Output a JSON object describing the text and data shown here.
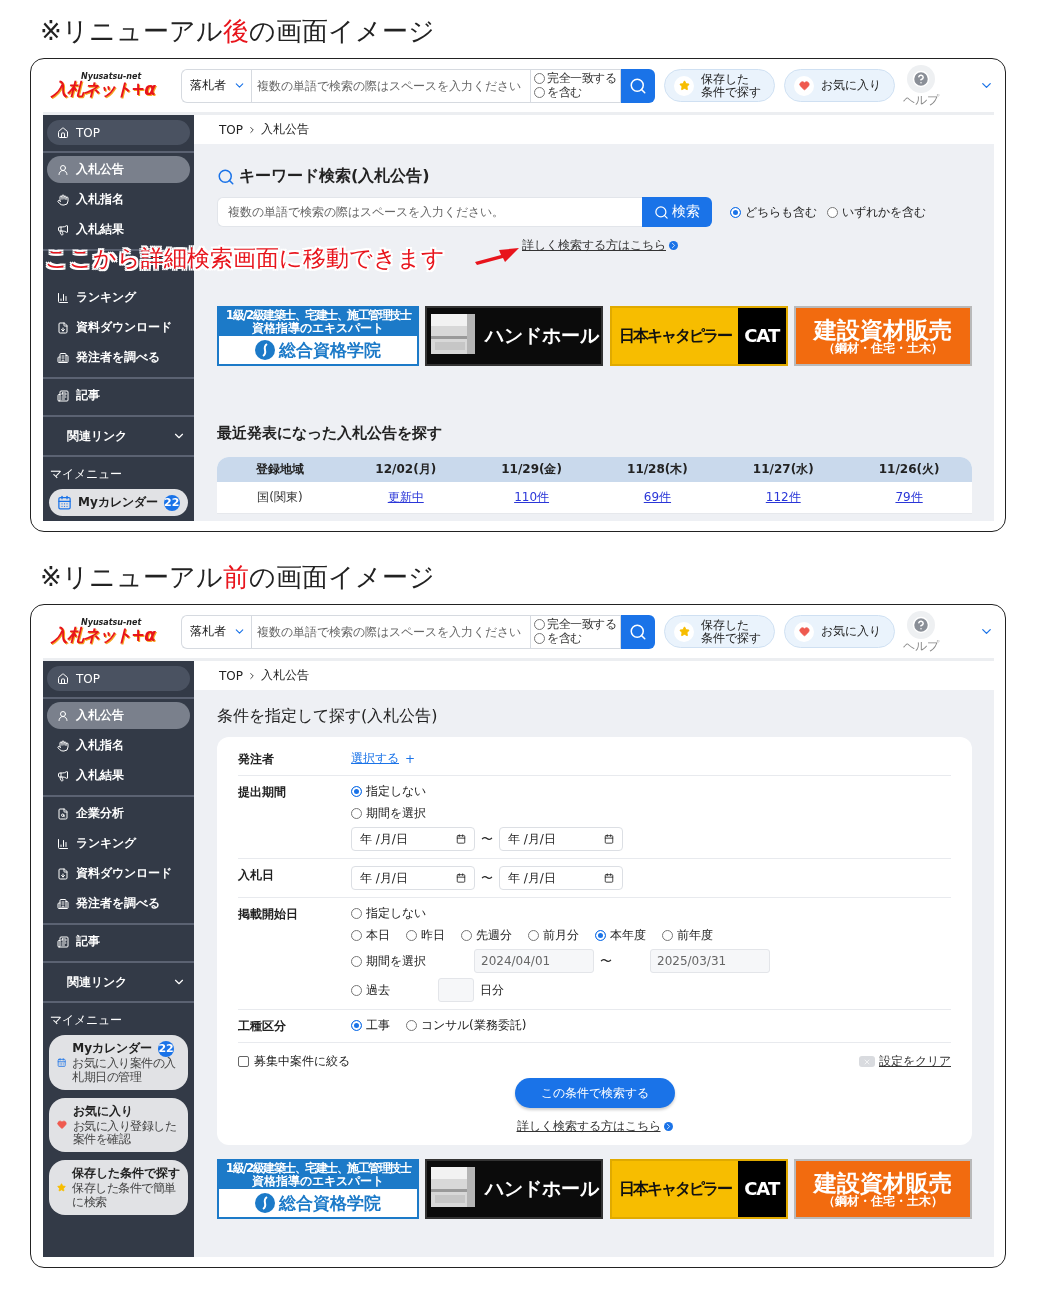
{
  "sections": [
    {
      "caption": {
        "before": "※リニューアル",
        "highlight": "後",
        "after": "の画面イメージ"
      },
      "annotation": "ここから詳細検索画面に移動できます",
      "screen": {
        "header": {
          "logo": {
            "main": "入札ネット+α",
            "sub": "Nyusatsu-net"
          },
          "search": {
            "select": "落札者",
            "placeholder": "複数の単語で検索の際はスペースを入力ください",
            "options": [
              {
                "label": "完全一致する",
                "selected": false
              },
              {
                "label": "を含む",
                "selected": false
              }
            ]
          },
          "saved": [
            "保存した",
            "条件で探す"
          ],
          "favorite": "お気に入り",
          "help": "ヘルプ"
        },
        "sidebar": {
          "top": "TOP",
          "groups": [
            {
              "items": [
                {
                  "label": "入札公告",
                  "selected": true
                },
                {
                  "label": "入札指名",
                  "selected": false
                },
                {
                  "label": "入札結果",
                  "selected": false
                }
              ]
            },
            {
              "items": [
                {
                  "kind": "covered"
                },
                {
                  "label": "ランキング",
                  "selected": false
                },
                {
                  "label": "資料ダウンロード",
                  "selected": false
                },
                {
                  "label": "発注者を調べる",
                  "selected": false
                }
              ]
            },
            {
              "items": [
                {
                  "label": "記事",
                  "selected": false
                }
              ]
            }
          ],
          "related": "関連リンク",
          "mymenu_title": "マイメニュー",
          "cards": [
            {
              "title": "Myカレンダー",
              "badge": "22"
            }
          ]
        },
        "breadcrumb": [
          "TOP",
          "入札公告"
        ],
        "main": {
          "kind": "keyword",
          "title": "キーワード検索(入札公告)",
          "placeholder": "複数の単語で検索の際はスペースを入力ください。",
          "button": "検索",
          "modes": [
            {
              "label": "どちらも含む",
              "selected": true
            },
            {
              "label": "いずれかを含む",
              "selected": false
            }
          ],
          "detail_link": "詳しく検索する方はこちら",
          "banners": [
            {
              "kind": "school",
              "lines": [
                "1級/2級建築士、宅建士、施工管理技士",
                "資格指導のエキスパート"
              ],
              "name": "総合資格学院"
            },
            {
              "kind": "handhole",
              "name": "ハンドホール"
            },
            {
              "kind": "cat",
              "name": "日本キャタピラー",
              "mark": "CAT"
            },
            {
              "kind": "materials",
              "name": "建設資材販売",
              "sub": "（鋼材・住宅・土木）"
            }
          ],
          "recent": {
            "title": "最近発表になった入札公告を探す",
            "columns": [
              "登録地域",
              "12/02(月)",
              "11/29(金)",
              "11/28(木)",
              "11/27(水)",
              "11/26(火)"
            ],
            "rows": [
              [
                "国(関東)",
                "更新中",
                "110件",
                "69件",
                "112件",
                "79件"
              ]
            ]
          }
        }
      }
    },
    {
      "caption": {
        "before": "※リニューアル",
        "highlight": "前",
        "after": "の画面イメージ"
      },
      "screen": {
        "header": {
          "logo": {
            "main": "入札ネット+α",
            "sub": "Nyusatsu-net"
          },
          "search": {
            "select": "落札者",
            "placeholder": "複数の単語で検索の際はスペースを入力ください",
            "options": [
              {
                "label": "完全一致する",
                "selected": false
              },
              {
                "label": "を含む",
                "selected": false
              }
            ]
          },
          "saved": [
            "保存した",
            "条件で探す"
          ],
          "favorite": "お気に入り",
          "help": "ヘルプ"
        },
        "sidebar": {
          "top": "TOP",
          "groups": [
            {
              "items": [
                {
                  "label": "入札公告",
                  "selected": true
                },
                {
                  "label": "入札指名",
                  "selected": false
                },
                {
                  "label": "入札結果",
                  "selected": false
                }
              ]
            },
            {
              "items": [
                {
                  "label": "企業分析",
                  "selected": false
                },
                {
                  "label": "ランキング",
                  "selected": false
                },
                {
                  "label": "資料ダウンロード",
                  "selected": false
                },
                {
                  "label": "発注者を調べる",
                  "selected": false
                }
              ]
            },
            {
              "items": [
                {
                  "label": "記事",
                  "selected": false
                }
              ]
            }
          ],
          "related": "関連リンク",
          "mymenu_title": "マイメニュー",
          "cards": [
            {
              "title": "Myカレンダー",
              "badge": "22",
              "sub": "お気に入り案件の入札期日の管理"
            },
            {
              "title": "お気に入り",
              "sub": "お気に入り登録した案件を確認"
            },
            {
              "title": "保存した条件で探す",
              "sub": "保存した条件で簡単に検索"
            }
          ]
        },
        "breadcrumb": [
          "TOP",
          "入札公告"
        ],
        "main": {
          "kind": "form",
          "title": "条件を指定して探す(入札公告)",
          "rows": [
            {
              "label": "発注者",
              "lines": [
                [
                  {
                    "kind": "link",
                    "text": "選択する"
                  },
                  {
                    "kind": "plus",
                    "text": "+"
                  }
                ]
              ]
            },
            {
              "label": "提出期間",
              "lines": [
                [
                  {
                    "kind": "radio",
                    "text": "指定しない",
                    "selected": true
                  }
                ],
                [
                  {
                    "kind": "radio",
                    "text": "期間を選択",
                    "selected": false
                  }
                ],
                [
                  {
                    "kind": "date",
                    "placeholder": "年 /月/日"
                  },
                  {
                    "kind": "text",
                    "text": "〜"
                  },
                  {
                    "kind": "date",
                    "placeholder": "年 /月/日"
                  }
                ]
              ]
            },
            {
              "label": "入札日",
              "lines": [
                [
                  {
                    "kind": "date",
                    "placeholder": "年 /月/日"
                  },
                  {
                    "kind": "text",
                    "text": "〜"
                  },
                  {
                    "kind": "date",
                    "placeholder": "年 /月/日"
                  }
                ]
              ]
            },
            {
              "label": "掲載開始日",
              "lines": [
                [
                  {
                    "kind": "radio",
                    "text": "指定しない",
                    "selected": false
                  }
                ],
                [
                  {
                    "kind": "radio",
                    "text": "本日",
                    "selected": false
                  },
                  {
                    "kind": "radio",
                    "text": "昨日",
                    "selected": false
                  },
                  {
                    "kind": "radio",
                    "text": "先週分",
                    "selected": false
                  },
                  {
                    "kind": "radio",
                    "text": "前月分",
                    "selected": false
                  },
                  {
                    "kind": "radio",
                    "text": "本年度",
                    "selected": true
                  },
                  {
                    "kind": "radio",
                    "text": "前年度",
                    "selected": false
                  }
                ],
                [
                  {
                    "kind": "radio",
                    "text": "期間を選択",
                    "selected": false
                  },
                  {
                    "kind": "field",
                    "value": "2024/04/01"
                  },
                  {
                    "kind": "text",
                    "text": "〜"
                  },
                  {
                    "kind": "field",
                    "value": "2025/03/31"
                  }
                ],
                [
                  {
                    "kind": "radio",
                    "text": "過去",
                    "selected": false
                  },
                  {
                    "kind": "small_field"
                  },
                  {
                    "kind": "text",
                    "text": "日分"
                  }
                ]
              ]
            },
            {
              "label": "工種区分",
              "lines": [
                [
                  {
                    "kind": "radio",
                    "text": "工事",
                    "selected": true
                  },
                  {
                    "kind": "radio",
                    "text": "コンサル(業務委託)",
                    "selected": false
                  }
                ]
              ]
            }
          ],
          "filter": {
            "label": "募集中案件に絞る",
            "checked": false
          },
          "clear": "設定をクリア",
          "submit": "この条件で検索する",
          "detail_link": "詳しく検索する方はこちら",
          "banners": [
            {
              "kind": "school",
              "lines": [
                "1級/2級建築士、宅建士、施工管理技士",
                "資格指導のエキスパート"
              ],
              "name": "総合資格学院"
            },
            {
              "kind": "handhole",
              "name": "ハンドホール"
            },
            {
              "kind": "cat",
              "name": "日本キャタピラー",
              "mark": "CAT"
            },
            {
              "kind": "materials",
              "name": "建設資材販売",
              "sub": "（鋼材・住宅・土木）"
            }
          ]
        }
      }
    }
  ]
}
